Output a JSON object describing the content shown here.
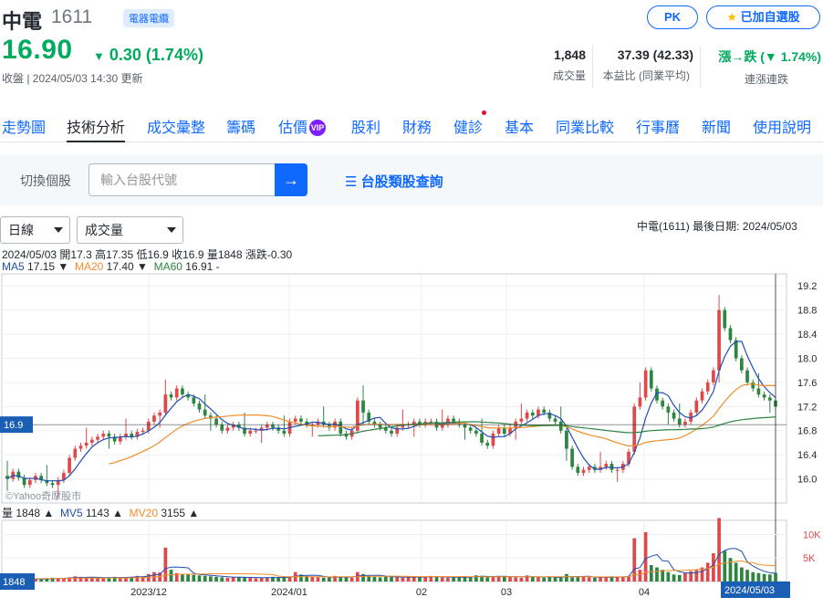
{
  "header": {
    "name": "中電",
    "code": "1611",
    "badge": "電器電纜",
    "price": "16.90",
    "change": "0.30 (1.74%)",
    "status": "收盤 | 2024/05/03 14:30 更新",
    "pk_label": "PK",
    "watchlist_label": "已加自選股",
    "stats": [
      {
        "value": "1,848",
        "label": "成交量"
      },
      {
        "value": "37.39 (42.33)",
        "label": "本益比 (同業平均)"
      },
      {
        "value": "漲→跌 (▼ 1.74%)",
        "label": "連漲連跌"
      }
    ]
  },
  "tabs": [
    "走勢圖",
    "技術分析",
    "成交彙整",
    "籌碼",
    "估價",
    "股利",
    "財務",
    "健診",
    "基本",
    "同業比較",
    "行事曆",
    "新聞",
    "使用說明"
  ],
  "vip_label": "VIP",
  "search": {
    "label": "切換個股",
    "placeholder": "輸入台股代號",
    "category_link": "台股類股查詢"
  },
  "controls": {
    "period": "日線",
    "indicator": "成交量"
  },
  "chart_info": "中電(1611)   最後日期: 2024/05/03",
  "ohlc_line": "2024/05/03 開17.3 高17.35 低16.9 收16.9 量1848 漲跌-0.30",
  "ma_labels": [
    {
      "name": "MA5",
      "value": "17.15 ▼",
      "color": "#1f4eb4"
    },
    {
      "name": "MA20",
      "value": "17.40 ▼",
      "color": "#f28e2b"
    },
    {
      "name": "MA60",
      "value": "16.91 -",
      "color": "#2e8540"
    }
  ],
  "vol_labels": [
    {
      "name": "量",
      "value": "1848 ▲",
      "color": "#232a31"
    },
    {
      "name": "MV5",
      "value": "1143 ▲",
      "color": "#1f4eb4"
    },
    {
      "name": "MV20",
      "value": "3155 ▲",
      "color": "#f28e2b"
    }
  ],
  "watermark": "©Yahoo奇摩股市",
  "colors": {
    "up": "#e0494b",
    "down": "#2e8540",
    "accent": "#0f69ff",
    "green": "#00ab5e"
  },
  "chart_data": {
    "type": "candlestick",
    "price_axis": {
      "ticks": [
        "19.2",
        "18.8",
        "18.4",
        "18.0",
        "17.6",
        "17.2",
        "16.8",
        "16.4",
        "16.0"
      ],
      "ylim": [
        15.6,
        19.4
      ]
    },
    "volume_axis": {
      "ticks": [
        "10K",
        "5K"
      ],
      "ylim": [
        0,
        13000
      ]
    },
    "x_ticks": [
      "2023/12",
      "2024/01",
      "02",
      "03",
      "04",
      "2024/05/03"
    ],
    "current_price_label": "16.9",
    "current_volume_label": "1848",
    "series": [
      {
        "name": "K",
        "values_close": [
          16.0,
          16.12,
          16.02,
          15.9,
          15.98,
          16.05,
          15.98,
          15.93,
          15.9,
          15.98,
          16.1,
          16.35,
          16.5,
          16.55,
          16.6,
          16.65,
          16.7,
          16.75,
          16.7,
          16.62,
          16.7,
          16.75,
          16.7,
          16.78,
          16.8,
          16.95,
          17.05,
          17.1,
          17.4,
          17.35,
          17.5,
          17.4,
          17.35,
          17.25,
          17.15,
          17.05,
          17.0,
          16.9,
          16.8,
          16.85,
          16.9,
          16.85,
          16.75,
          16.8,
          16.8,
          16.85,
          16.9,
          16.85,
          16.8,
          16.75,
          16.95,
          17.0,
          16.95,
          16.9,
          16.9,
          16.95,
          16.9,
          16.85,
          16.95,
          16.75,
          16.7,
          16.8,
          17.3,
          17.1,
          16.95,
          16.9,
          16.85,
          16.8,
          16.75,
          16.85,
          16.9,
          16.9,
          16.95,
          16.9,
          16.95,
          16.95,
          16.85,
          16.9,
          17.0,
          16.95,
          16.9,
          16.85,
          16.8,
          16.75,
          16.6,
          16.55,
          16.75,
          16.85,
          16.75,
          16.85,
          16.95,
          17.0,
          17.1,
          17.05,
          17.15,
          17.1,
          17.0,
          16.95,
          16.8,
          16.5,
          16.2,
          16.1,
          16.15,
          16.2,
          16.15,
          16.2,
          16.25,
          16.15,
          16.15,
          16.25,
          16.45,
          17.2,
          17.35,
          17.8,
          17.5,
          17.3,
          17.2,
          17.1,
          17.0,
          16.9,
          16.95,
          17.1,
          17.3,
          17.45,
          17.6,
          17.8,
          18.8,
          18.5,
          18.3,
          18.0,
          17.8,
          17.6,
          17.5,
          17.4,
          17.35,
          17.3,
          17.2
        ]
      },
      {
        "name": "量",
        "values": [
          900,
          700,
          600,
          500,
          400,
          500,
          600,
          700,
          800,
          700,
          600,
          900,
          1100,
          1000,
          900,
          800,
          700,
          800,
          900,
          1000,
          900,
          800,
          1000,
          1200,
          1100,
          1600,
          2000,
          1900,
          7200,
          2500,
          1800,
          1600,
          1500,
          1400,
          1300,
          1200,
          1100,
          1000,
          900,
          800,
          900,
          1000,
          900,
          800,
          700,
          800,
          900,
          1000,
          900,
          800,
          1000,
          2000,
          1500,
          1200,
          1000,
          900,
          800,
          900,
          1200,
          1000,
          900,
          800,
          2000,
          1600,
          1200,
          1000,
          900,
          1100,
          1000,
          900,
          800,
          1000,
          1100,
          1000,
          900,
          1200,
          1000,
          900,
          800,
          900,
          1000,
          1100,
          900,
          1300,
          1200,
          900,
          1000,
          1100,
          1200,
          1000,
          900,
          800,
          1300,
          1000,
          900,
          800,
          1000,
          900,
          800,
          1600,
          900,
          1100,
          1000,
          900,
          800,
          900,
          1000,
          1100,
          900,
          1000,
          1200,
          9200,
          2500,
          10500,
          3500,
          3000,
          2500,
          2000,
          1500,
          1400,
          1800,
          2200,
          2500,
          3000,
          4000,
          6000,
          13500,
          6500,
          5000,
          4000,
          3000,
          2500,
          2000,
          1800,
          1600,
          1500,
          1848
        ]
      }
    ]
  }
}
